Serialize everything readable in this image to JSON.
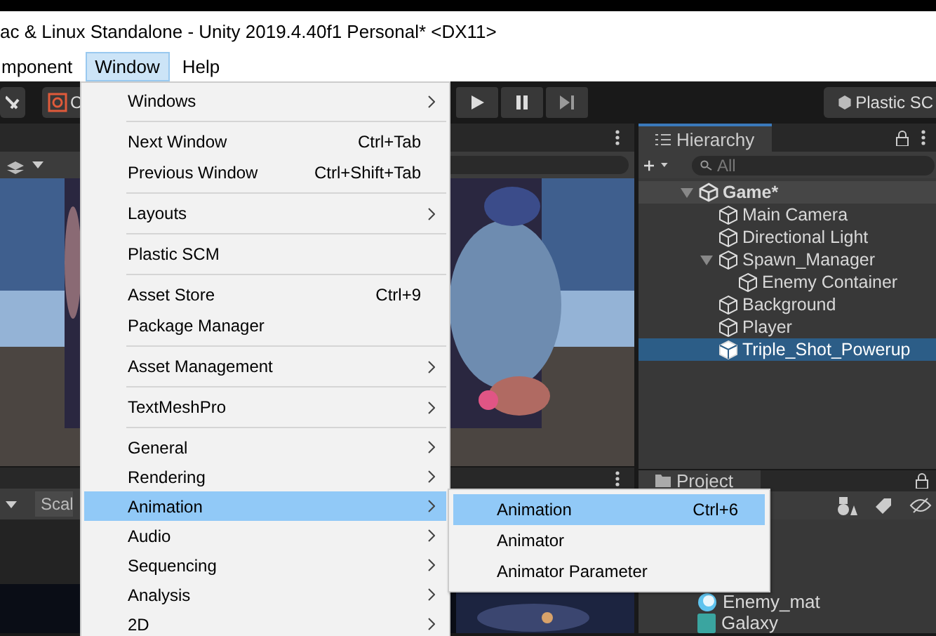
{
  "window": {
    "title": "ac & Linux Standalone - Unity 2019.4.40f1 Personal* <DX11>"
  },
  "menubar": [
    {
      "label": "mponent",
      "selected": false
    },
    {
      "label": "Window",
      "selected": true
    },
    {
      "label": "Help",
      "selected": false
    }
  ],
  "toolbar": {
    "tool_label": "C",
    "plastic_button": "Plastic SC"
  },
  "game_panel": {
    "scale_label": "Scal",
    "kind": "picture"
  },
  "hierarchy": {
    "tab": "Hierarchy",
    "search_placeholder": "All",
    "tree": [
      {
        "label": "Game*",
        "kind": "scene",
        "expanded": true,
        "selected": false,
        "children": [
          {
            "label": "Main Camera",
            "kind": "object",
            "selected": false
          },
          {
            "label": "Directional Light",
            "kind": "object",
            "selected": false
          },
          {
            "label": "Spawn_Manager",
            "kind": "object",
            "expanded": true,
            "selected": false,
            "children": [
              {
                "label": "Enemy Container",
                "kind": "object",
                "selected": false
              }
            ]
          },
          {
            "label": "Background",
            "kind": "object",
            "selected": false
          },
          {
            "label": "Player",
            "kind": "object",
            "selected": false
          },
          {
            "label": "Triple_Shot_Powerup",
            "kind": "object",
            "selected": true
          }
        ]
      }
    ]
  },
  "project": {
    "tab": "Project",
    "items": [
      {
        "label": "Enemy_mat",
        "kind": "material"
      },
      {
        "label": "Galaxy",
        "kind": "shader"
      }
    ]
  },
  "window_menu": {
    "groups": [
      [
        {
          "label": "Windows",
          "submenu": true,
          "selected": false
        }
      ],
      [
        {
          "label": "Next Window",
          "shortcut": "Ctrl+Tab",
          "selected": false
        },
        {
          "label": "Previous Window",
          "shortcut": "Ctrl+Shift+Tab",
          "selected": false
        }
      ],
      [
        {
          "label": "Layouts",
          "submenu": true,
          "selected": false
        }
      ],
      [
        {
          "label": "Plastic SCM",
          "selected": false
        }
      ],
      [
        {
          "label": "Asset Store",
          "shortcut": "Ctrl+9",
          "selected": false
        },
        {
          "label": "Package Manager",
          "selected": false
        }
      ],
      [
        {
          "label": "Asset Management",
          "submenu": true,
          "selected": false
        }
      ],
      [
        {
          "label": "TextMeshPro",
          "submenu": true,
          "selected": false
        }
      ],
      [
        {
          "label": "General",
          "submenu": true,
          "selected": false
        },
        {
          "label": "Rendering",
          "submenu": true,
          "selected": false
        },
        {
          "label": "Animation",
          "submenu": true,
          "selected": true
        },
        {
          "label": "Audio",
          "submenu": true,
          "selected": false
        },
        {
          "label": "Sequencing",
          "submenu": true,
          "selected": false
        },
        {
          "label": "Analysis",
          "submenu": true,
          "selected": false
        },
        {
          "label": "2D",
          "submenu": true,
          "selected": false
        }
      ]
    ]
  },
  "submenu": {
    "items": [
      {
        "label": "Animation",
        "shortcut": "Ctrl+6",
        "selected": true
      },
      {
        "label": "Animator",
        "selected": false
      },
      {
        "label": "Animator Parameter",
        "selected": false
      }
    ]
  }
}
